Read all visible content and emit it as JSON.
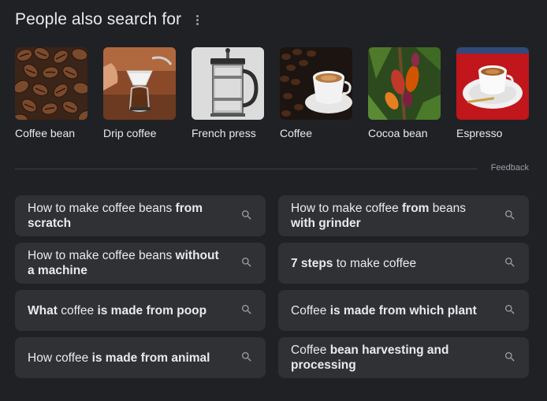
{
  "header": {
    "title": "People also search for",
    "more_icon": "more-vert-icon"
  },
  "entities": [
    {
      "label": "Coffee bean"
    },
    {
      "label": "Drip coffee"
    },
    {
      "label": "French press"
    },
    {
      "label": "Coffee"
    },
    {
      "label": "Cocoa bean"
    },
    {
      "label": "Espresso"
    }
  ],
  "feedback_label": "Feedback",
  "related_searches": [
    {
      "parts": [
        {
          "t": "How to make coffee beans ",
          "b": false
        },
        {
          "t": "from scratch",
          "b": true
        }
      ]
    },
    {
      "parts": [
        {
          "t": "How to make coffee ",
          "b": false
        },
        {
          "t": "from",
          "b": true
        },
        {
          "t": " beans ",
          "b": false
        },
        {
          "t": "with grinder",
          "b": true
        }
      ]
    },
    {
      "parts": [
        {
          "t": "How to make coffee beans ",
          "b": false
        },
        {
          "t": "without a machine",
          "b": true
        }
      ]
    },
    {
      "parts": [
        {
          "t": "7 steps",
          "b": true
        },
        {
          "t": " to make coffee",
          "b": false
        }
      ]
    },
    {
      "parts": [
        {
          "t": "What",
          "b": true
        },
        {
          "t": " coffee ",
          "b": false
        },
        {
          "t": "is made from poop",
          "b": true
        }
      ]
    },
    {
      "parts": [
        {
          "t": "Coffee ",
          "b": false
        },
        {
          "t": "is made from which plant",
          "b": true
        }
      ]
    },
    {
      "parts": [
        {
          "t": "How coffee ",
          "b": false
        },
        {
          "t": "is made from animal",
          "b": true
        }
      ]
    },
    {
      "parts": [
        {
          "t": "Coffee ",
          "b": false
        },
        {
          "t": "bean harvesting and processing",
          "b": true
        }
      ]
    }
  ],
  "colors": {
    "background": "#202124",
    "chip": "#303134",
    "text": "#e8eaed",
    "muted": "#9aa0a6"
  },
  "search_icon": "search-icon"
}
